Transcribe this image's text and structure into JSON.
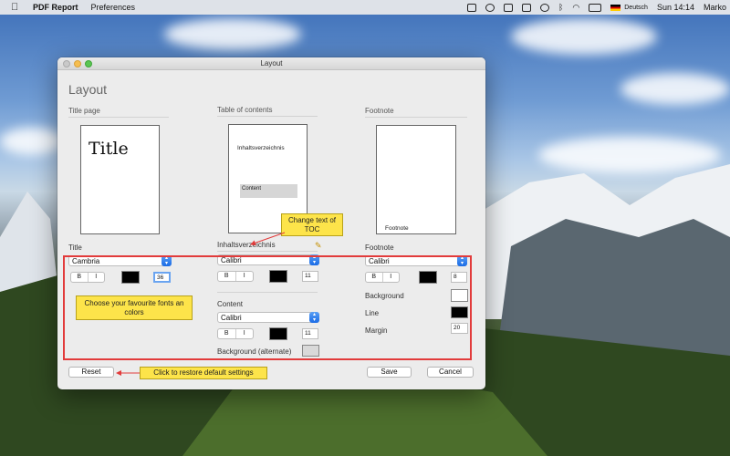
{
  "menubar": {
    "apple_icon": "apple-logo-icon",
    "app_name": "PDF Report",
    "menus": [
      "Preferences"
    ],
    "status_icons": [
      "dropbox-icon",
      "info-icon",
      "screen-icon",
      "airplay-icon",
      "time-machine-icon",
      "bluetooth-icon",
      "wifi-icon",
      "battery-icon",
      "german-flag-icon"
    ],
    "input_source": "Deutsch",
    "clock": "Sun 14:14",
    "user": "Marko"
  },
  "window": {
    "title": "Layout",
    "heading": "Layout",
    "sections": {
      "title_page": "Title page",
      "toc": "Table of contents",
      "footnote": "Footnote"
    },
    "previews": {
      "title_text": "Title",
      "toc_title": "Inhaltsverzeichnis",
      "toc_content": "Content",
      "footnote_text": "Footnote"
    },
    "title_settings": {
      "label": "Title",
      "font": "Cambria",
      "bold": "B",
      "italic": "I",
      "color": "#000000",
      "size": "36"
    },
    "toc_settings": {
      "title_value": "Inhaltsverzeichnis",
      "font": "Calibri",
      "bold": "B",
      "italic": "I",
      "color": "#000000",
      "size": "11",
      "content_label": "Content",
      "content_font": "Calibri",
      "content_bold": "B",
      "content_italic": "I",
      "content_color": "#000000",
      "content_size": "11",
      "background_label": "Background (alternate)",
      "background_color": "#d9d9d9"
    },
    "footnote_settings": {
      "label": "Footnote",
      "font": "Calibri",
      "bold": "B",
      "italic": "I",
      "color": "#000000",
      "size": "8",
      "background_label": "Background",
      "background_color": "#ffffff",
      "line_label": "Line",
      "line_color": "#000000",
      "margin_label": "Margin",
      "margin_value": "20"
    },
    "buttons": {
      "reset": "Reset",
      "save": "Save",
      "cancel": "Cancel"
    }
  },
  "annotations": {
    "toc_note": "Change text of TOC",
    "fonts_note": "Choose your favourite fonts an colors",
    "reset_note": "Click to restore default settings",
    "highlight_color": "#e23b3b",
    "note_color": "#fde44a"
  }
}
